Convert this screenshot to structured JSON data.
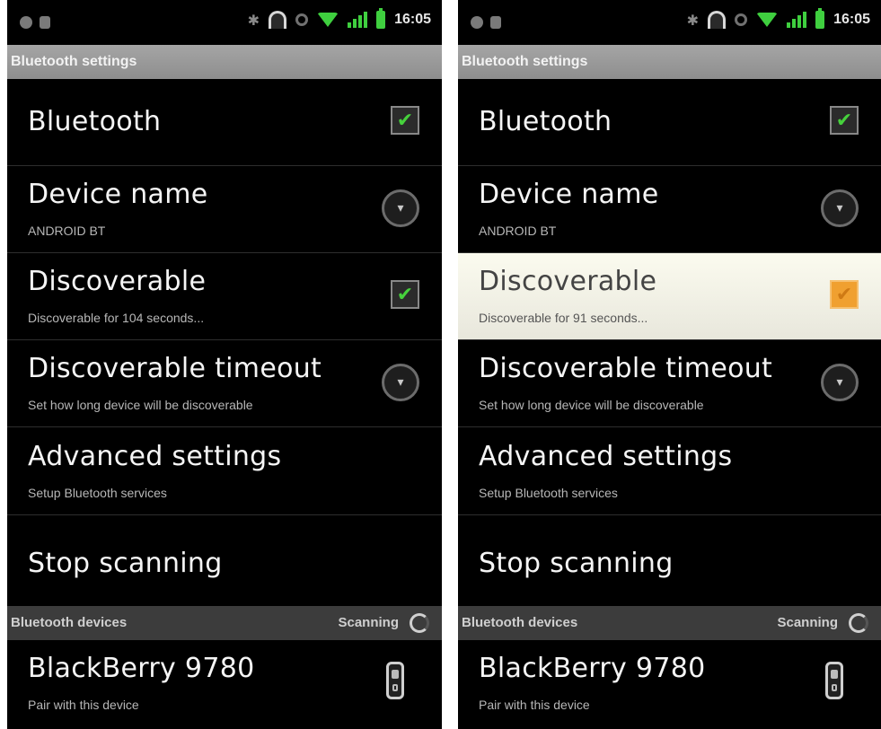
{
  "screens": [
    {
      "status_time": "16:05",
      "title": "Bluetooth settings",
      "rows": [
        {
          "title": "Bluetooth",
          "subtitle": "",
          "control": "check",
          "checked": true
        },
        {
          "title": "Device name",
          "subtitle": "ANDROID BT",
          "control": "radio"
        },
        {
          "title": "Discoverable",
          "subtitle": "Discoverable for 104 seconds...",
          "control": "check",
          "checked": true
        },
        {
          "title": "Discoverable timeout",
          "subtitle": "Set how long device will be discoverable",
          "control": "radio"
        },
        {
          "title": "Advanced settings",
          "subtitle": "Setup Bluetooth services",
          "control": "none"
        },
        {
          "title": "Stop scanning",
          "subtitle": "",
          "control": "none"
        }
      ],
      "section_label": "Bluetooth devices",
      "scan_status": "Scanning",
      "device": {
        "title": "BlackBerry 9780",
        "subtitle": "Pair with this device"
      }
    },
    {
      "status_time": "16:05",
      "title": "Bluetooth settings",
      "rows": [
        {
          "title": "Bluetooth",
          "subtitle": "",
          "control": "check",
          "checked": true
        },
        {
          "title": "Device name",
          "subtitle": "ANDROID BT",
          "control": "radio"
        },
        {
          "title": "Discoverable",
          "subtitle": "Discoverable for 91 seconds...",
          "control": "check",
          "checked": true,
          "highlighted": true
        },
        {
          "title": "Discoverable timeout",
          "subtitle": "Set how long device will be discoverable",
          "control": "radio"
        },
        {
          "title": "Advanced settings",
          "subtitle": "Setup Bluetooth services",
          "control": "none"
        },
        {
          "title": "Stop scanning",
          "subtitle": "",
          "control": "none"
        }
      ],
      "section_label": "Bluetooth devices",
      "scan_status": "Scanning",
      "device": {
        "title": "BlackBerry 9780",
        "subtitle": "Pair with this device"
      }
    }
  ],
  "icons": {
    "check_glyph": "✔",
    "radio_glyph": "▾",
    "bluetooth_glyph": "✱"
  },
  "colors": {
    "check_green": "#46d13c",
    "highlight_orange": "#f0a030",
    "wifi_green": "#3fcf3f"
  }
}
